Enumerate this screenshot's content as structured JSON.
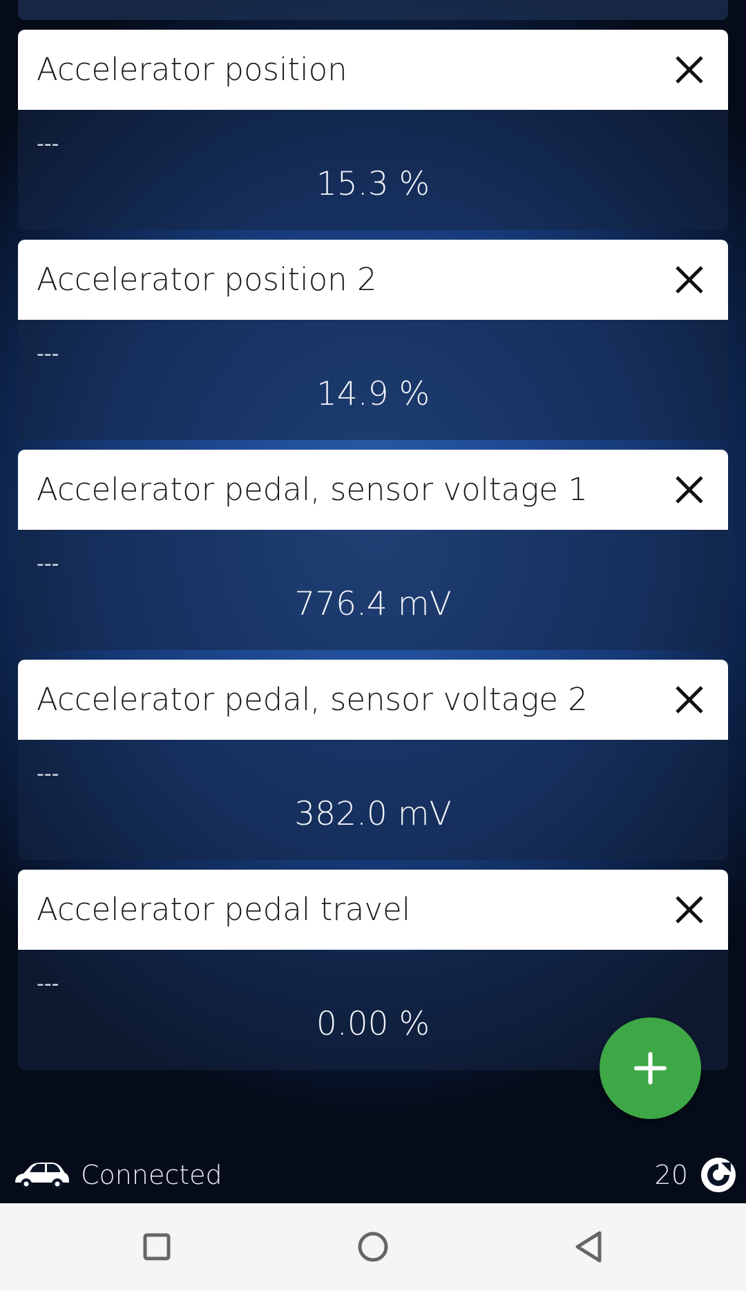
{
  "cards": [
    {
      "title": "Accelerator position",
      "dashes": "---",
      "value": "15.3 %"
    },
    {
      "title": "Accelerator position 2",
      "dashes": "---",
      "value": "14.9 %"
    },
    {
      "title": "Accelerator pedal, sensor voltage 1",
      "dashes": "---",
      "value": "776.4 mV"
    },
    {
      "title": "Accelerator pedal, sensor voltage 2",
      "dashes": "---",
      "value": "382.0 mV"
    },
    {
      "title": "Accelerator pedal travel",
      "dashes": "---",
      "value": "0.00 %"
    }
  ],
  "fab": {
    "icon": "plus-icon"
  },
  "status": {
    "car_icon": "car-icon",
    "connection": "Connected",
    "count": "20",
    "refresh_icon": "refresh-icon"
  },
  "navbar": {
    "items": [
      "recents-icon",
      "home-icon",
      "back-icon"
    ]
  },
  "colors": {
    "accent": "#3ea846",
    "card_header": "#ffffff",
    "background": "#1f4a93"
  }
}
